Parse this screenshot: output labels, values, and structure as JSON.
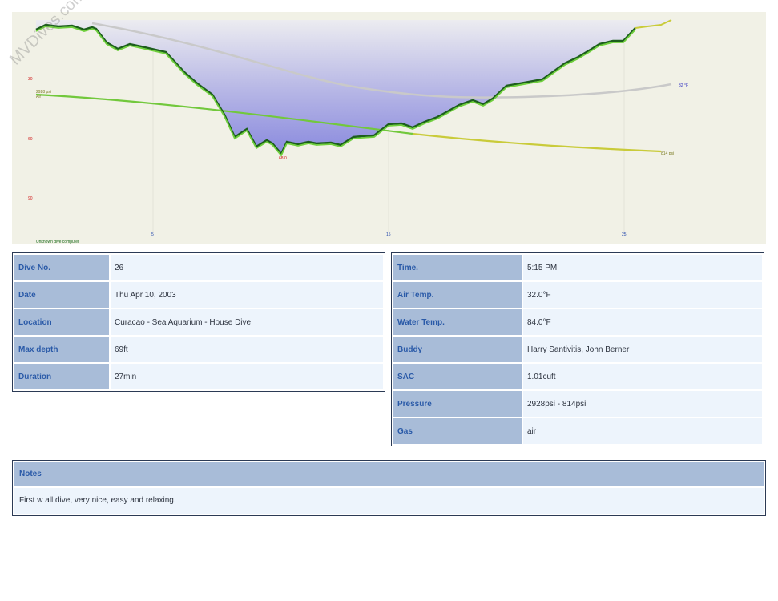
{
  "watermark": "MVDives.com",
  "profile": {
    "footer": "Unknown dive computer",
    "start_pressure": "2928 psi",
    "gas_label": "Air",
    "end_pressure": "814 psi",
    "end_temp": "32 °F",
    "max_depth_label": "68.0",
    "depth_axis_labels": [
      "30",
      "60",
      "90"
    ],
    "time_axis_labels": [
      "5",
      "15",
      "25"
    ],
    "colors": {
      "background": "#f1f1e6",
      "depth_fill_top": "#e8e8ee",
      "depth_fill_bottom": "#8e8ee0",
      "depth_line": "#6fcf3d",
      "depth_line_dark": "#1d5e1d",
      "pressure_line": "#6fcf3d",
      "pressure_line_end": "#d6d63a",
      "temp_line": "#c8c8c8",
      "axis_label": "#d11a1a",
      "time_label": "#1a3fa8"
    }
  },
  "left_table": [
    {
      "key": "Dive No.",
      "value": "26"
    },
    {
      "key": "Date",
      "value": "Thu Apr 10, 2003"
    },
    {
      "key": "Location",
      "value": "Curacao - Sea Aquarium - House Dive"
    },
    {
      "key": "Max depth",
      "value": "69ft"
    },
    {
      "key": "Duration",
      "value": "27min"
    }
  ],
  "right_table": [
    {
      "key": "Time.",
      "value": "5:15 PM"
    },
    {
      "key": "Air Temp.",
      "value": "32.0°F"
    },
    {
      "key": "Water Temp.",
      "value": "84.0°F"
    },
    {
      "key": "Buddy",
      "value": "Harry Santivitis, John Berner"
    },
    {
      "key": "SAC",
      "value": "1.01cuft"
    },
    {
      "key": "Pressure",
      "value": "2928psi - 814psi"
    },
    {
      "key": "Gas",
      "value": "air"
    }
  ],
  "notes": {
    "header": "Notes",
    "text": "First w all dive, very nice, easy and relaxing."
  }
}
